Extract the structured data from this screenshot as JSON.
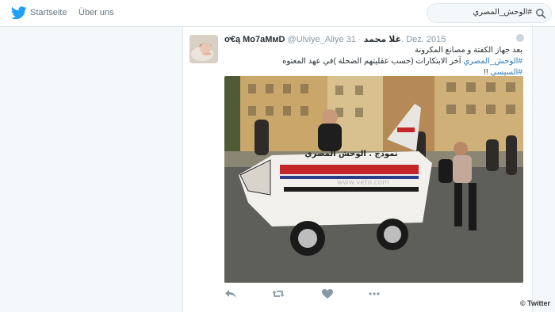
{
  "nav": {
    "home": "Startseite",
    "about": "Über uns"
  },
  "search": {
    "query": "#الوحش_المصري"
  },
  "tweet": {
    "name": "ơ€ą Mo7aMмD",
    "handle": "@Ulviye_Aliye",
    "name_ar": "غلا محمد",
    "date": "31. Dez. 2015",
    "line1": "بعد جهاز الكفتة و مصانع المكرونة",
    "line2_hashtag": "#الوحش_المصري",
    "line2_rest": " آخر الابتكارات (حسب عقليتهم الضحلة )في عهد المعتوه ",
    "line2_hashtag2": "#السيسي",
    "line2_end": " !!",
    "image_text": "نموذج . الوحش المصري",
    "watermark": "www.veto.com"
  },
  "credit": "© Twitter",
  "colors": {
    "brand": "#1da1f2",
    "link": "#2b7bb9",
    "background": "#f5f8fa"
  },
  "icons": [
    "twitter-bird-icon",
    "search-icon",
    "reply-icon",
    "retweet-icon",
    "like-icon",
    "more-icon",
    "dropdown-caret-icon"
  ]
}
